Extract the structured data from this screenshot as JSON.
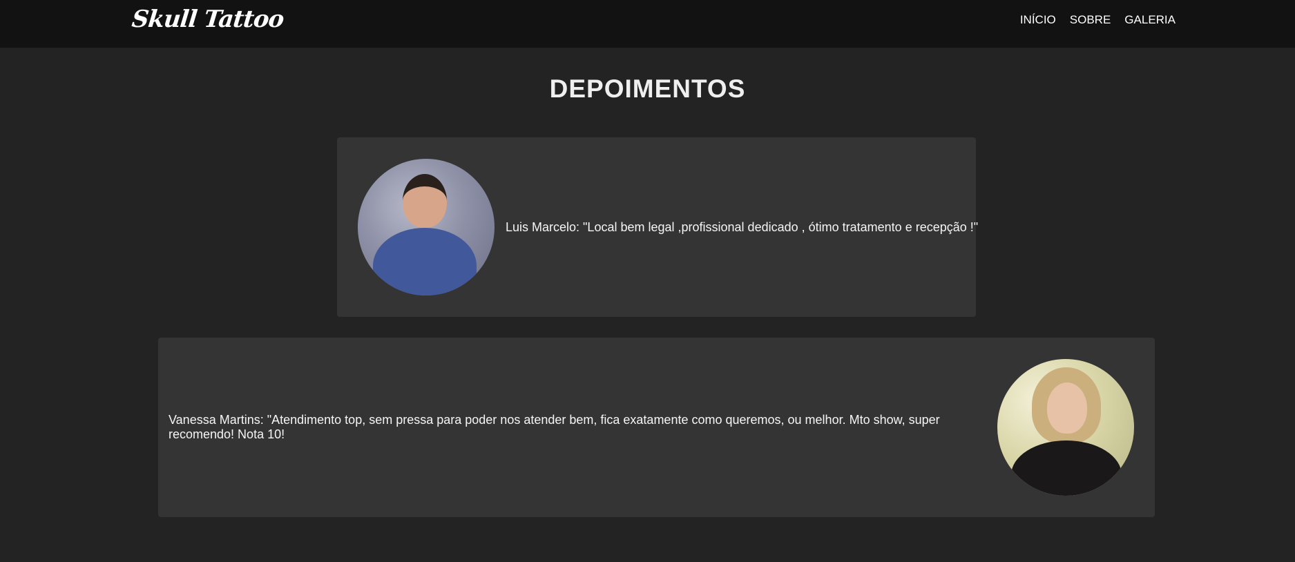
{
  "brand": {
    "logo_text": "Skull Tattoo"
  },
  "nav": {
    "items": [
      {
        "label": "INÍCIO"
      },
      {
        "label": "SOBRE"
      },
      {
        "label": "GALERIA"
      }
    ]
  },
  "testimonials": {
    "title": "DEPOIMENTOS",
    "items": [
      {
        "text": "Luis Marcelo: \"Local bem legal ,profissional dedicado , ótimo tratamento e recepção !\""
      },
      {
        "text": "Vanessa Martins: \"Atendimento top, sem pressa para poder nos atender bem, fica exatamente como queremos, ou melhor. Mto show, super recomendo! Nota 10!"
      }
    ]
  },
  "colors": {
    "navbar_bg": "#121212",
    "page_bg": "#232323",
    "card_bg": "#343434",
    "text": "#f2f2f2"
  }
}
